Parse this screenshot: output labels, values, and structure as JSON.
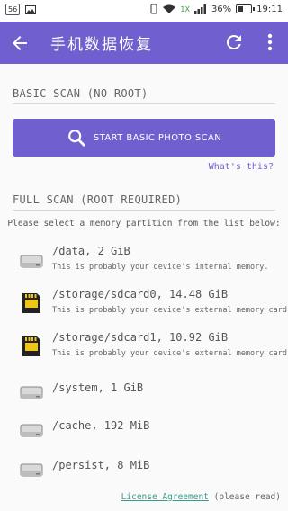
{
  "status_bar": {
    "notification_count": "56",
    "network": "1X",
    "battery_percent": "36%",
    "battery_level": 0.36,
    "time": "19:11"
  },
  "app_bar": {
    "title": "手机数据恢复",
    "back_icon": "arrow-back-icon",
    "refresh_icon": "refresh-icon",
    "more_icon": "more-vert-icon"
  },
  "basic_scan": {
    "header": "BASIC SCAN (NO ROOT)",
    "button_label": "START BASIC PHOTO SCAN",
    "button_icon": "search-icon",
    "help_link": "What's this?"
  },
  "full_scan": {
    "header": "FULL SCAN (ROOT REQUIRED)",
    "instruction": "Please select a memory partition from the list below:",
    "partitions": [
      {
        "name": "/data, 2 GiB",
        "description": "This is probably your device's internal memory.",
        "icon": "hard-drive-icon"
      },
      {
        "name": "/storage/sdcard0, 14.48 GiB",
        "description": "This is probably your device's external memory card.",
        "icon": "sd-card-icon"
      },
      {
        "name": "/storage/sdcard1, 10.92 GiB",
        "description": "This is probably your device's external memory card.",
        "icon": "sd-card-icon"
      },
      {
        "name": "/system, 1 GiB",
        "description": "",
        "icon": "hard-drive-icon"
      },
      {
        "name": "/cache, 192 MiB",
        "description": "",
        "icon": "hard-drive-icon"
      },
      {
        "name": "/persist, 8 MiB",
        "description": "",
        "icon": "hard-drive-icon"
      }
    ]
  },
  "footer": {
    "license_link": "License Agreement",
    "license_note": "(please read)"
  },
  "colors": {
    "accent": "#6f5fcf",
    "link": "#3a9b8a",
    "sd_card": "#f0c419"
  }
}
